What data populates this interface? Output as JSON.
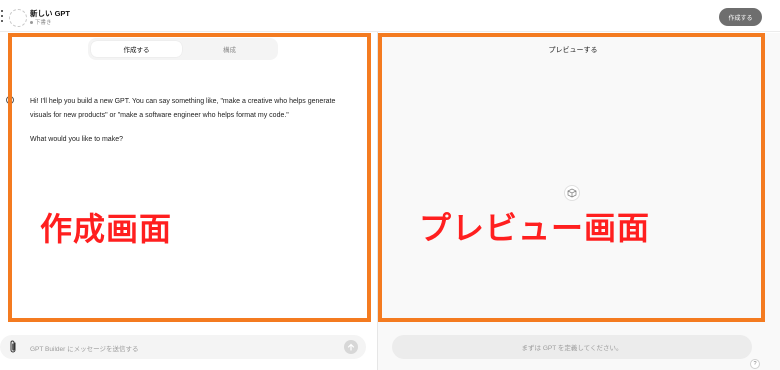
{
  "header": {
    "gpt_name": "新しい GPT",
    "status": "下書き",
    "create_button": "作成する"
  },
  "left": {
    "tabs": [
      {
        "label": "作成する",
        "active": true
      },
      {
        "label": "構成",
        "active": false
      }
    ],
    "message_paragraph_1": "Hi! I'll help you build a new GPT. You can say something like, \"make a creative who helps generate visuals for new products\" or \"make a software engineer who helps format my code.\"",
    "message_paragraph_2": "What would you like to make?",
    "composer_placeholder": "GPT Builder にメッセージを送信する"
  },
  "right": {
    "title": "プレビューする",
    "input_placeholder": "まずは GPT を定義してください。",
    "help_label": "?"
  },
  "annotations": {
    "left_label": "作成画面",
    "right_label": "プレビュー画面",
    "color": "#f47b20",
    "text_color": "#ff1f1f"
  },
  "icons": {
    "menu": "kebab-menu-icon",
    "avatar": "gpt-avatar-placeholder",
    "bot": "bot-icon",
    "attach": "paperclip-icon",
    "send": "arrow-up-icon",
    "preview": "cube-icon"
  }
}
